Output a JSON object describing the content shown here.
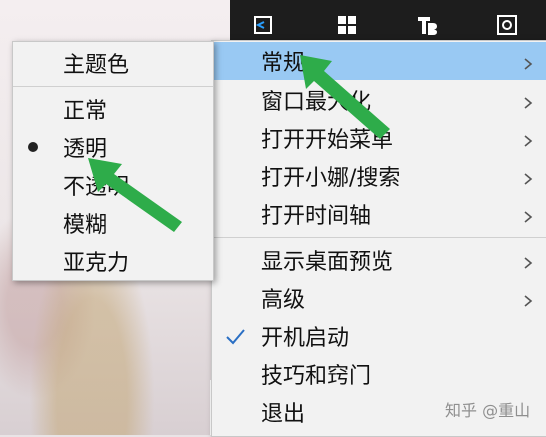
{
  "colors": {
    "menu_bg": "#f2f2f2",
    "highlight": "#99c9f3",
    "taskbar": "#1d1d1d",
    "arrow_green": "#2eac4a"
  },
  "taskbar_icons": [
    "arrow-left-icon",
    "windows-grid-icon",
    "tb-logo-icon",
    "settings-square-icon"
  ],
  "main_menu": {
    "items": [
      {
        "label": "常规",
        "submenu": true,
        "highlighted": true
      },
      {
        "label": "窗口最大化",
        "submenu": true
      },
      {
        "label": "打开开始菜单",
        "submenu": true
      },
      {
        "label": "打开小娜/搜索",
        "submenu": true
      },
      {
        "label": "打开时间轴",
        "submenu": true
      },
      {
        "label": "显示桌面预览",
        "submenu": true
      },
      {
        "label": "高级",
        "submenu": true
      },
      {
        "label": "开机启动",
        "checked": true
      },
      {
        "label": "技巧和窍门"
      },
      {
        "label": "退出"
      }
    ]
  },
  "sub_menu": {
    "header": "主题色",
    "items": [
      {
        "label": "正常"
      },
      {
        "label": "透明",
        "selected": true
      },
      {
        "label": "不透明"
      },
      {
        "label": "模糊"
      },
      {
        "label": "亚克力"
      }
    ]
  },
  "watermark": "知乎 @重山"
}
